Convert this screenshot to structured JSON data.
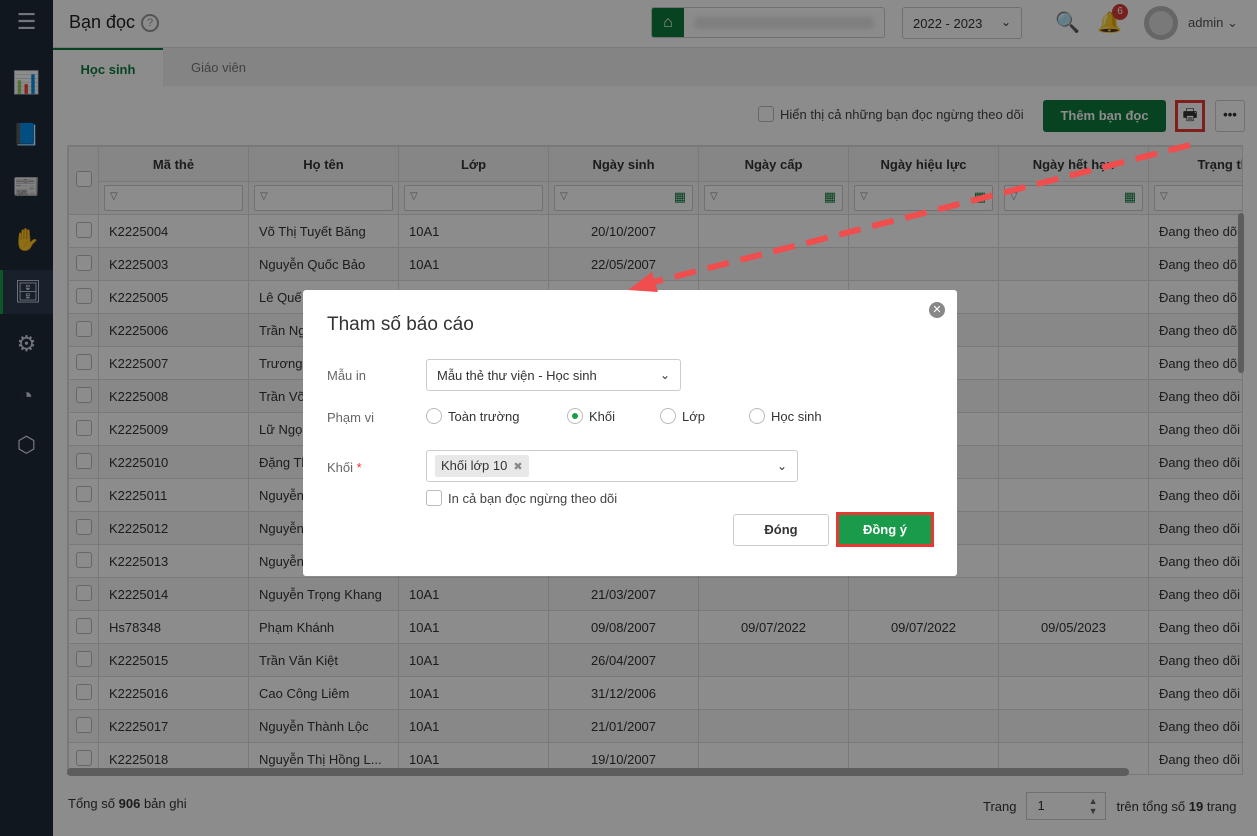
{
  "app": {
    "title": "Bạn đọc",
    "help": "?"
  },
  "header": {
    "school_year": "2022 - 2023",
    "notif_count": "6",
    "user": "admin"
  },
  "sidebar": {
    "items": [
      "menu",
      "dashboard",
      "books",
      "news",
      "borrow",
      "readers",
      "settings",
      "reports",
      "inventory"
    ]
  },
  "tabs": [
    {
      "label": "Học sinh"
    },
    {
      "label": "Giáo viên"
    }
  ],
  "toolbar": {
    "show_inactive": "Hiển thị cả những bạn đọc ngừng theo dõi",
    "add_label": "Thêm bạn đọc",
    "more": "•••"
  },
  "table": {
    "columns": [
      "Mã thẻ",
      "Họ tên",
      "Lớp",
      "Ngày sinh",
      "Ngày cấp",
      "Ngày hiệu lực",
      "Ngày hết hạn",
      "Trạng thái"
    ],
    "rows": [
      [
        "K2225004",
        "Võ Thị Tuyết Băng",
        "10A1",
        "20/10/2007",
        "",
        "",
        "",
        "Đang theo dõi"
      ],
      [
        "K2225003",
        "Nguyễn Quốc Bảo",
        "10A1",
        "22/05/2007",
        "",
        "",
        "",
        "Đang theo dõi"
      ],
      [
        "K2225005",
        "Lê Quế",
        "",
        "",
        "",
        "",
        "",
        "Đang theo dõi"
      ],
      [
        "K2225006",
        "Trần Ng",
        "",
        "",
        "",
        "",
        "",
        "Đang theo dõi"
      ],
      [
        "K2225007",
        "Trương",
        "",
        "",
        "",
        "",
        "",
        "Đang theo dõi"
      ],
      [
        "K2225008",
        "Trần Võ",
        "",
        "",
        "",
        "",
        "",
        "Đang theo dõi"
      ],
      [
        "K2225009",
        "Lữ Ngọ",
        "",
        "",
        "",
        "",
        "",
        "Đang theo dõi"
      ],
      [
        "K2225010",
        "Đặng Th",
        "",
        "",
        "",
        "",
        "",
        "Đang theo dõi"
      ],
      [
        "K2225011",
        "Nguyễn",
        "",
        "",
        "",
        "",
        "",
        "Đang theo dõi"
      ],
      [
        "K2225012",
        "Nguyễn",
        "",
        "",
        "",
        "",
        "",
        "Đang theo dõi"
      ],
      [
        "K2225013",
        "Nguyễn",
        "",
        "",
        "",
        "",
        "",
        "Đang theo dõi"
      ],
      [
        "K2225014",
        "Nguyễn Trọng Khang",
        "10A1",
        "21/03/2007",
        "",
        "",
        "",
        "Đang theo dõi"
      ],
      [
        "Hs78348",
        "Phạm Khánh",
        "10A1",
        "09/08/2007",
        "09/07/2022",
        "09/07/2022",
        "09/05/2023",
        "Đang theo dõi"
      ],
      [
        "K2225015",
        "Trần Văn Kiệt",
        "10A1",
        "26/04/2007",
        "",
        "",
        "",
        "Đang theo dõi"
      ],
      [
        "K2225016",
        "Cao Công Liêm",
        "10A1",
        "31/12/2006",
        "",
        "",
        "",
        "Đang theo dõi"
      ],
      [
        "K2225017",
        "Nguyễn Thành Lộc",
        "10A1",
        "21/01/2007",
        "",
        "",
        "",
        "Đang theo dõi"
      ],
      [
        "K2225018",
        "Nguyễn Thị Hồng L...",
        "10A1",
        "19/10/2007",
        "",
        "",
        "",
        "Đang theo dõi"
      ]
    ]
  },
  "footer": {
    "total_prefix": "Tổng số",
    "total": "906",
    "total_suffix": "bản ghi",
    "page_label": "Trang",
    "page": "1",
    "pages_prefix": "trên tổng số",
    "pages": "19",
    "pages_suffix": "trang"
  },
  "modal": {
    "title": "Tham số báo cáo",
    "template_label": "Mẫu in",
    "template_value": "Mẫu thẻ thư viện - Học sinh",
    "scope_label": "Phạm vi",
    "scope_options": [
      "Toàn trường",
      "Khối",
      "Lớp",
      "Học sinh"
    ],
    "scope_selected": "Khối",
    "grade_label": "Khối",
    "required": "*",
    "grade_tag": "Khối lớp 10",
    "include_inactive": "In cả bạn đọc ngừng theo dõi",
    "close_label": "Đóng",
    "ok_label": "Đồng ý"
  },
  "colors": {
    "brand": "#0d7a3c",
    "accent": "#1a9b4b",
    "highlight": "#e53935"
  }
}
